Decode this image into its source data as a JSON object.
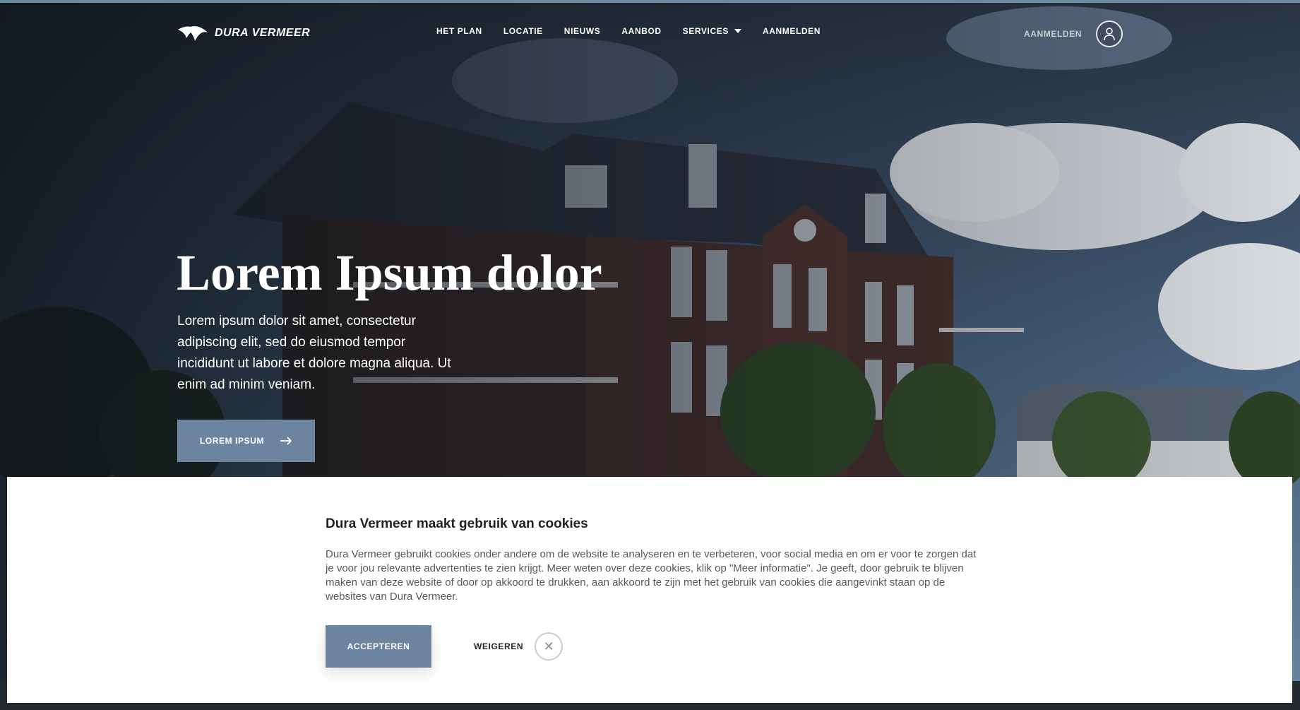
{
  "brand": {
    "logo_text": "DURA VERMEER"
  },
  "nav": {
    "items": [
      {
        "label": "HET PLAN"
      },
      {
        "label": "LOCATIE"
      },
      {
        "label": "NIEUWS"
      },
      {
        "label": "AANBOD"
      },
      {
        "label": "SERVICES",
        "has_dropdown": true
      },
      {
        "label": "AANMELDEN"
      }
    ],
    "login_label": "AANMELDEN",
    "login_icon": "user-icon"
  },
  "hero": {
    "title": "Lorem Ipsum dolor",
    "text": "Lorem ipsum dolor sit amet, consectetur adipiscing elit, sed do eiusmod tempor incididunt ut labore et dolore magna aliqua. Ut enim ad minim veniam.",
    "button_label": "LOREM IPSUM",
    "button_icon": "arrow-right-icon"
  },
  "cookie": {
    "title": "Dura Vermeer maakt gebruik van cookies",
    "body": "Dura Vermeer gebruikt cookies onder andere om de website te analyseren en te verbeteren, voor social media en om er voor te zorgen dat je voor jou relevante advertenties te zien krijgt. Meer weten over deze cookies, klik op \"Meer informatie\". Je geeft, door gebruik te blijven maken van deze website of door op akkoord te drukken, aan akkoord te zijn met het gebruik van cookies die aangevinkt staan op de websites van Dura Vermeer.",
    "accept_label": "ACCEPTEREN",
    "reject_label": "WEIGEREN",
    "reject_icon": "close-icon"
  },
  "colors": {
    "accent": "#6c84a0",
    "overlay": "#1d2530"
  }
}
